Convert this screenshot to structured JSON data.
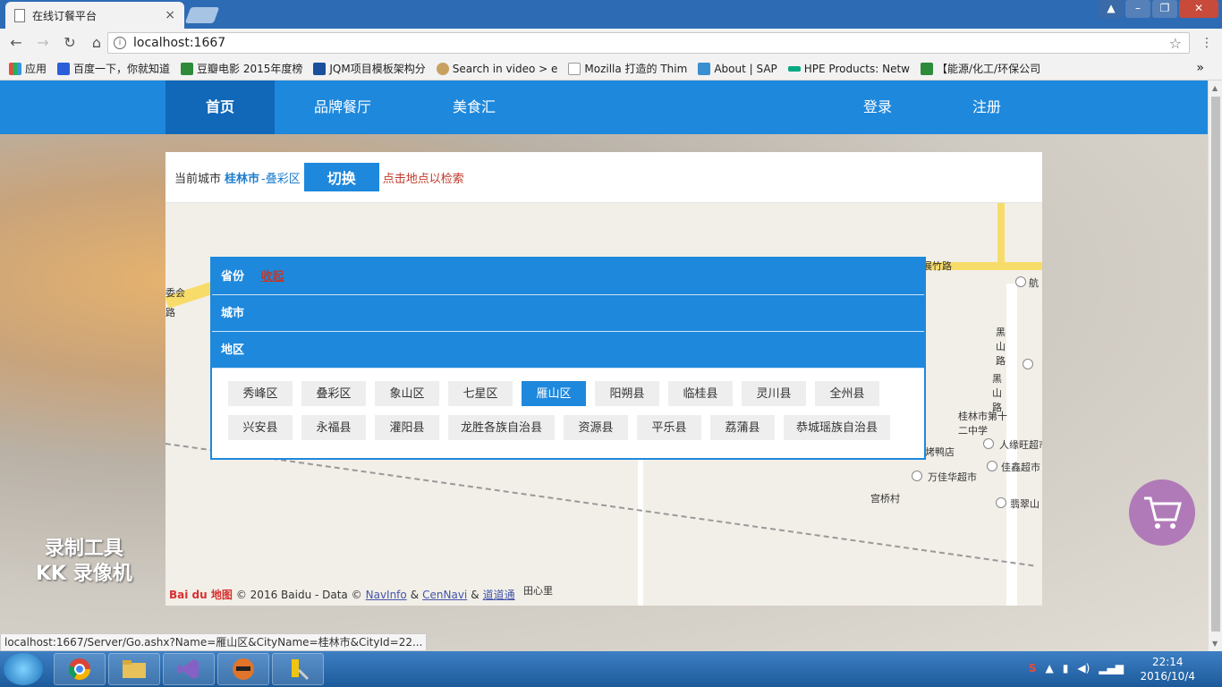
{
  "browser": {
    "tab_title": "在线订餐平台",
    "tab_close": "×",
    "url": "localhost:1667",
    "bookmarks": [
      "应用",
      "百度一下，你就知道",
      "豆瓣电影 2015年度榜",
      "JQM项目模板架构分",
      "Search in video > e",
      "Mozilla 打造的 Thim",
      "About | SAP",
      "HPE Products: Netw",
      "【能源/化工/环保公司"
    ],
    "bookmarks_more": "»",
    "status_url": "localhost:1667/Server/Go.ashx?Name=雁山区&CityName=桂林市&CityId=22..."
  },
  "nav": {
    "items": [
      "首页",
      "品牌餐厅",
      "美食汇"
    ],
    "right": [
      "登录",
      "注册"
    ]
  },
  "city_bar": {
    "prefix": "当前城市",
    "city": "桂林市",
    "district": "-叠彩区",
    "switch_label": "切换",
    "hint": "点击地点以检索"
  },
  "selector": {
    "province_label": "省份",
    "collapse_label": "收起",
    "city_label": "城市",
    "district_label": "地区",
    "districts": [
      "秀峰区",
      "叠彩区",
      "象山区",
      "七星区",
      "雁山区",
      "阳朔县",
      "临桂县",
      "灵川县",
      "全州县",
      "兴安县",
      "永福县",
      "灌阳县",
      "龙胜各族自治县",
      "资源县",
      "平乐县",
      "荔蒲县",
      "恭城瑶族自治县"
    ],
    "active_district": "雁山区"
  },
  "map": {
    "labels": {
      "road": "展竹路",
      "hang": "航",
      "heishan": "黑山路",
      "heishan2": "黑山路",
      "school": "桂林市第十二中学",
      "duck": "口留香烤鸭店",
      "market1": "人缘旺超市",
      "market2": "佳鑫超市",
      "market3": "万佳华超市",
      "village": "宫桥村",
      "cui": "翡翠山",
      "tianxin": "田心里",
      "weihui": "委会",
      "lu": "路"
    },
    "footer": {
      "logo": "Bai du 地图",
      "copyright": "© 2016 Baidu - Data ©",
      "navinfo": "NavInfo",
      "amp1": "&",
      "cennavi": "CenNavi",
      "amp2": "&",
      "daodao": "道道通"
    }
  },
  "watermark": {
    "line1": "录制工具",
    "line2": "KK 录像机"
  },
  "taskbar": {
    "time": "22:14",
    "date": "2016/10/4"
  },
  "colors": {
    "primary": "#1e88dc",
    "active_nav": "#1167b8",
    "hint": "#c0392b"
  }
}
